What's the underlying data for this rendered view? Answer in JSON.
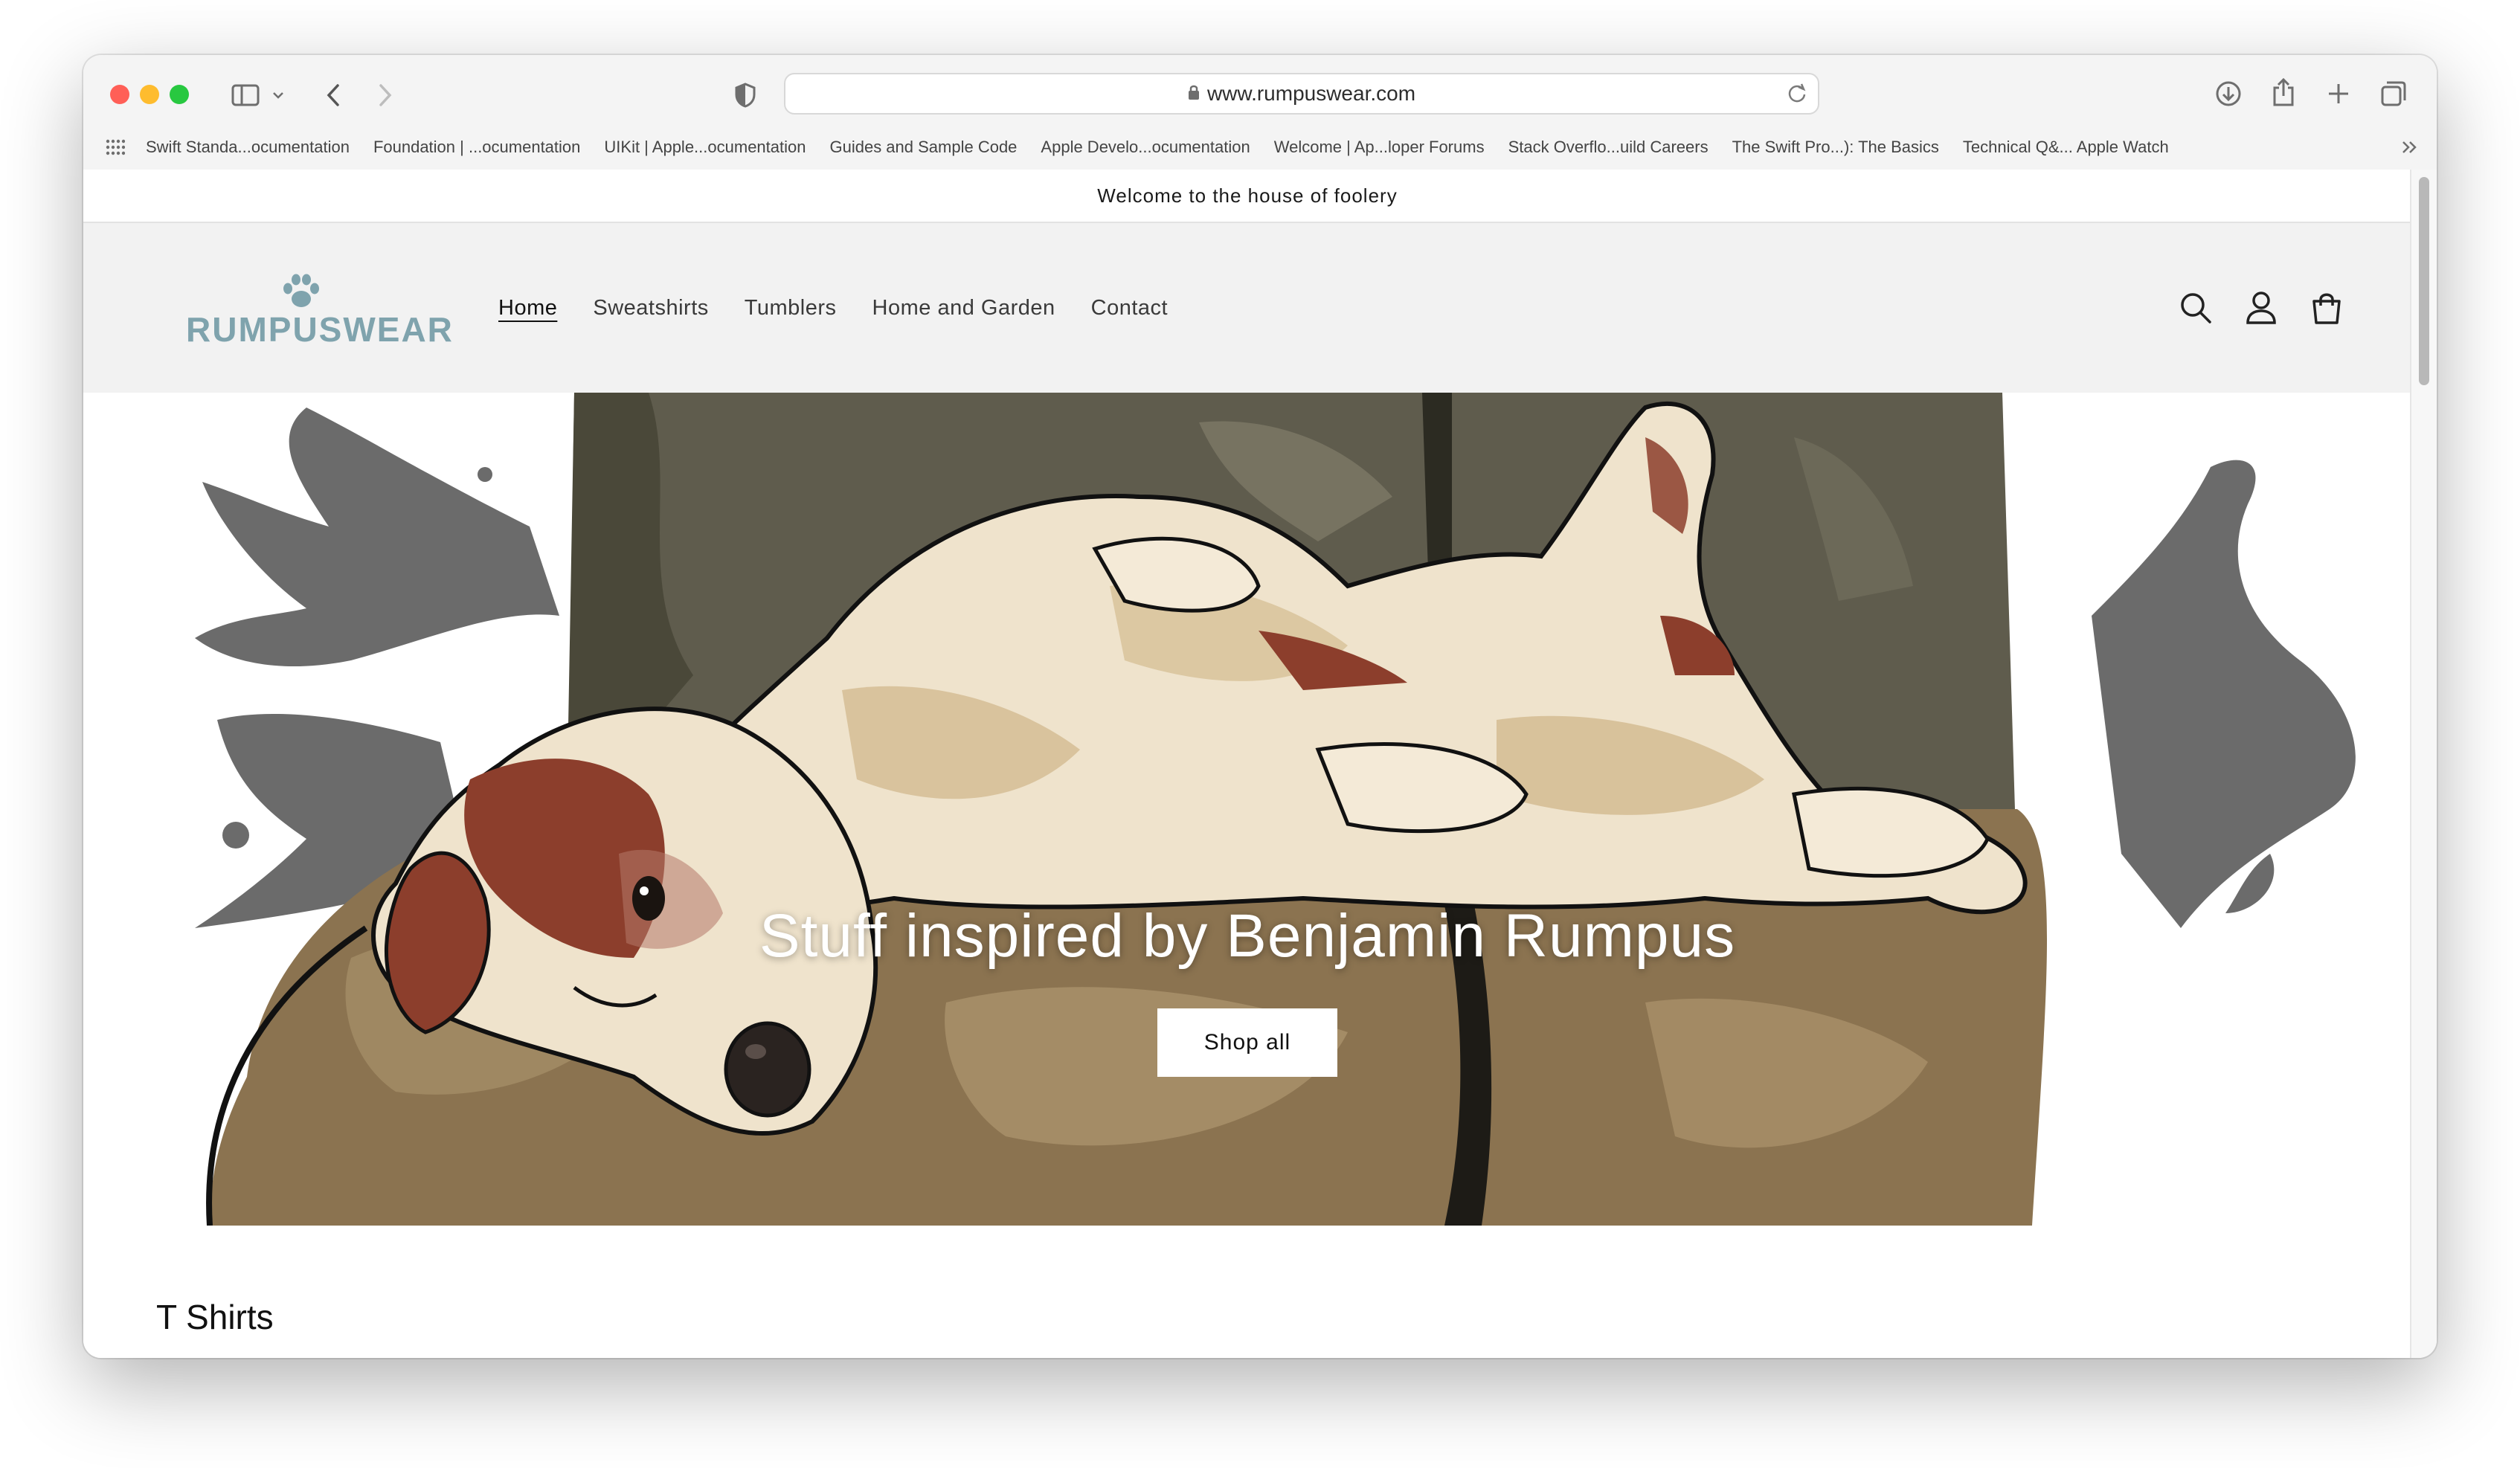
{
  "browser": {
    "url": "www.rumpuswear.com",
    "bookmarks": [
      "Swift Standa...ocumentation",
      "Foundation | ...ocumentation",
      "UIKit | Apple...ocumentation",
      "Guides and Sample Code",
      "Apple Develo...ocumentation",
      "Welcome | Ap...loper Forums",
      "Stack Overflo...uild Careers",
      "The Swift Pro...): The Basics",
      "Technical Q&... Apple Watch"
    ]
  },
  "announcement": "Welcome to the house of foolery",
  "header": {
    "logo_text": "RUMPUSWEAR",
    "nav": [
      "Home",
      "Sweatshirts",
      "Tumblers",
      "Home and Garden",
      "Contact"
    ],
    "active_nav": "Home"
  },
  "hero": {
    "title": "Stuff inspired by Benjamin Rumpus",
    "button_label": "Shop all"
  },
  "section": {
    "title": "T Shirts"
  },
  "colors": {
    "logo": "#7fa3ad",
    "header_bg": "#f2f2f2",
    "sofa_dark": "#5f5c4d",
    "cushion": "#8b7350",
    "dog_cream": "#efe3cc",
    "dog_brown": "#8c3e2c"
  }
}
